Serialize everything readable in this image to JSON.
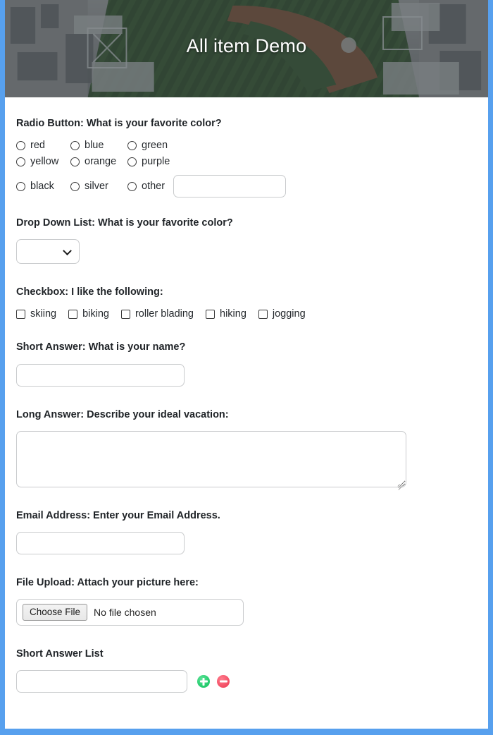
{
  "header": {
    "title": "All item Demo",
    "image_name": "stadium-aerial-photo"
  },
  "theme": {
    "border_color": "#57a0ee",
    "add_icon_color": "#2bcf72",
    "remove_icon_color": "#f5566c",
    "label_color": "#1f2327"
  },
  "form": {
    "radio_section": {
      "label": "Radio Button: What is your favorite color?",
      "row1": [
        {
          "label": "red"
        },
        {
          "label": "blue"
        },
        {
          "label": "green"
        }
      ],
      "row2": [
        {
          "label": "yellow"
        },
        {
          "label": "orange"
        },
        {
          "label": "purple"
        }
      ],
      "row3": [
        {
          "label": "black"
        },
        {
          "label": "silver"
        },
        {
          "label": "other"
        }
      ],
      "other_value": "",
      "other_placeholder": ""
    },
    "dropdown_section": {
      "label": "Drop Down List: What is your favorite color?",
      "selected": "",
      "options": []
    },
    "checkbox_section": {
      "label": "Checkbox: I like the following:",
      "options": [
        {
          "label": "skiing"
        },
        {
          "label": "biking"
        },
        {
          "label": "roller blading"
        },
        {
          "label": "hiking"
        },
        {
          "label": "jogging"
        }
      ]
    },
    "short_answer_section": {
      "label": "Short Answer: What is your name?",
      "value": "",
      "placeholder": ""
    },
    "long_answer_section": {
      "label": "Long Answer: Describe your ideal vacation:",
      "value": "",
      "placeholder": ""
    },
    "email_section": {
      "label": "Email Address: Enter your Email Address.",
      "value": "",
      "placeholder": ""
    },
    "file_section": {
      "label": "File Upload: Attach your picture here:",
      "button_label": "Choose File",
      "file_status": "No file chosen"
    },
    "short_answer_list_section": {
      "label": "Short Answer List",
      "value": "",
      "placeholder": "",
      "add_label": "+",
      "remove_label": "−"
    }
  }
}
